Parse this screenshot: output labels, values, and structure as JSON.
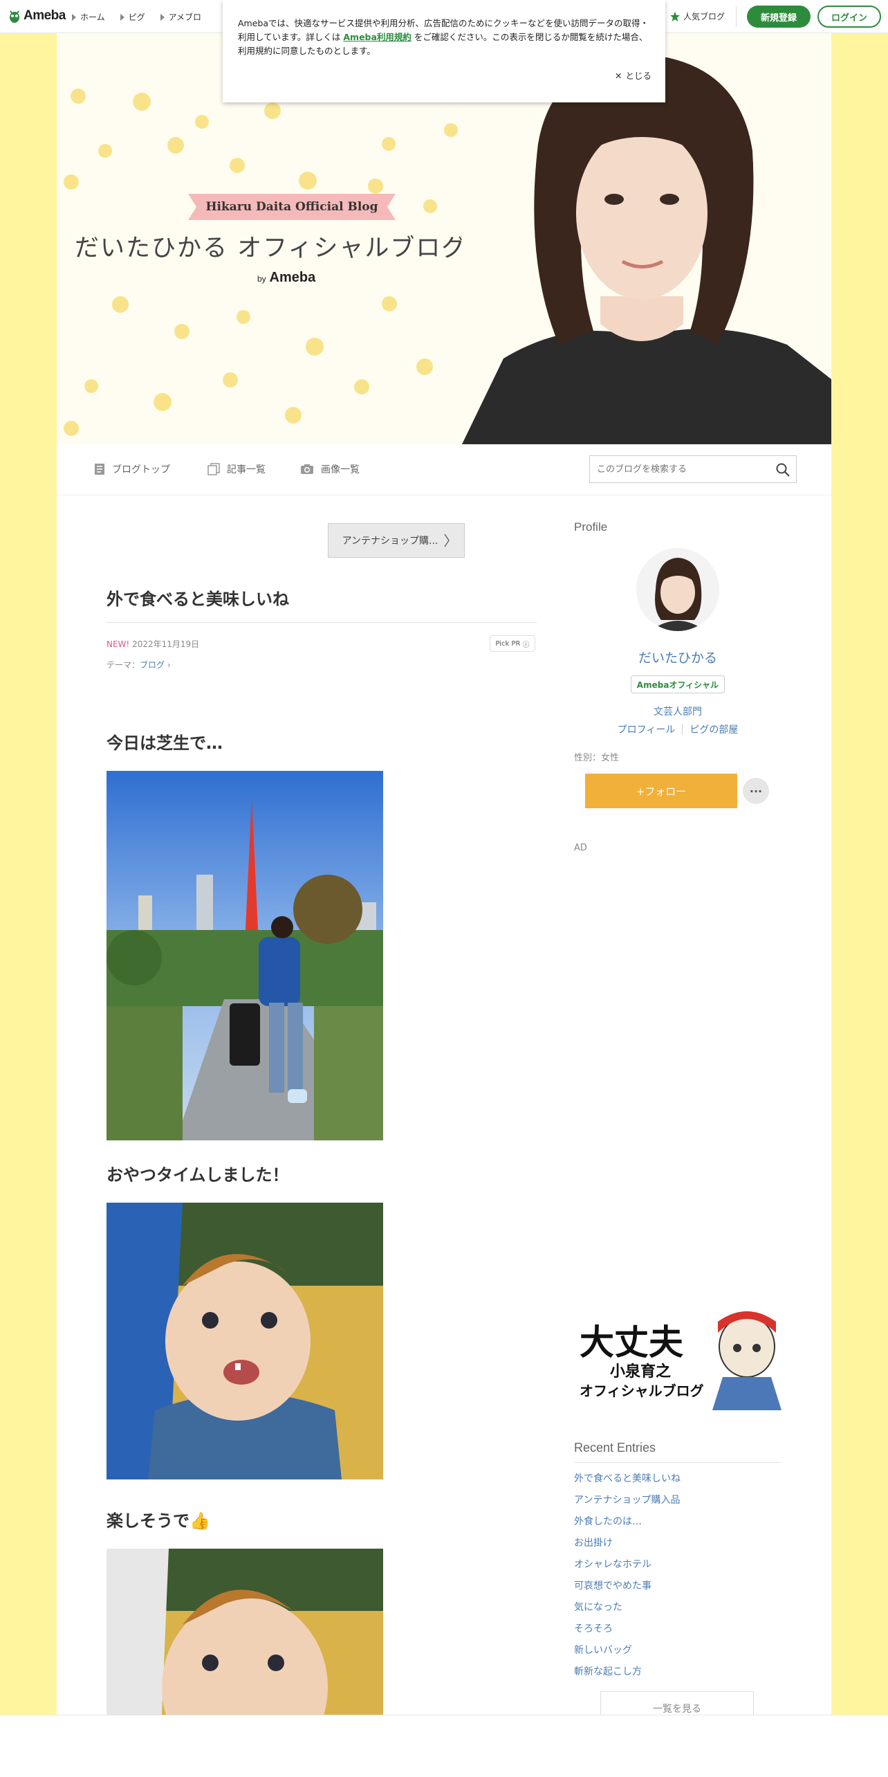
{
  "topbar": {
    "logo": "Ameba",
    "nav": [
      "ホーム",
      "ピグ",
      "アメブロ"
    ],
    "popular": "人気ブログ",
    "register": "新規登録",
    "login": "ログイン"
  },
  "cookie": {
    "text_before": "Amebaでは、快適なサービス提供や利用分析、広告配信のためにクッキーなどを使い訪問データの取得・利用しています。詳しくは",
    "link": "Ameba利用規約",
    "text_after": "をご確認ください。この表示を閉じるか閲覧を続けた場合、利用規約に同意したものとします。",
    "close": "とじる"
  },
  "header": {
    "ribbon": "Hikaru Daita Official Blog",
    "title": "だいたひかる オフィシャルブログ",
    "by": "by",
    "brand": "Ameba"
  },
  "blognav": {
    "top": "ブログトップ",
    "list": "記事一覧",
    "images": "画像一覧",
    "search_placeholder": "このブログを検索する"
  },
  "entry": {
    "pr_box": "アンテナショップ購...",
    "title": "外で食べると美味しいね",
    "new": "NEW!",
    "date": "2022年11月19日",
    "pickpr": "Pick PR",
    "theme_label": "テーマ：",
    "theme": "ブログ",
    "h1": "今日は芝生で…",
    "h2": "おやつタイムしました！",
    "h3": "楽しそうで"
  },
  "sidebar": {
    "profile": "Profile",
    "name": "だいたひかる",
    "official": "Amebaオフィシャル",
    "dept": "文芸人部門",
    "link_profile": "プロフィール",
    "link_pig": "ピグの部屋",
    "gender": "性別：女性",
    "follow": "+フォロー",
    "more": "···",
    "ad": "AD",
    "banner_line1": "大丈夫",
    "banner_line2": "小泉育之",
    "banner_line3": "オフィシャルブログ",
    "recent_title": "Recent Entries",
    "recent": [
      "外で食べると美味しいね",
      "アンテナショップ購入品",
      "外食したのは…",
      "お出掛け",
      "オシャレなホテル",
      "可哀想でやめた事",
      "気になった",
      "そろそろ",
      "新しいバッグ",
      "斬新な起こし方"
    ],
    "see_all": "一覧を見る"
  },
  "colors": {
    "brand_green": "#2d8c3c",
    "background_yellow": "#fff59f",
    "follow_orange": "#f0b03a",
    "link_blue": "#4a7db6"
  }
}
